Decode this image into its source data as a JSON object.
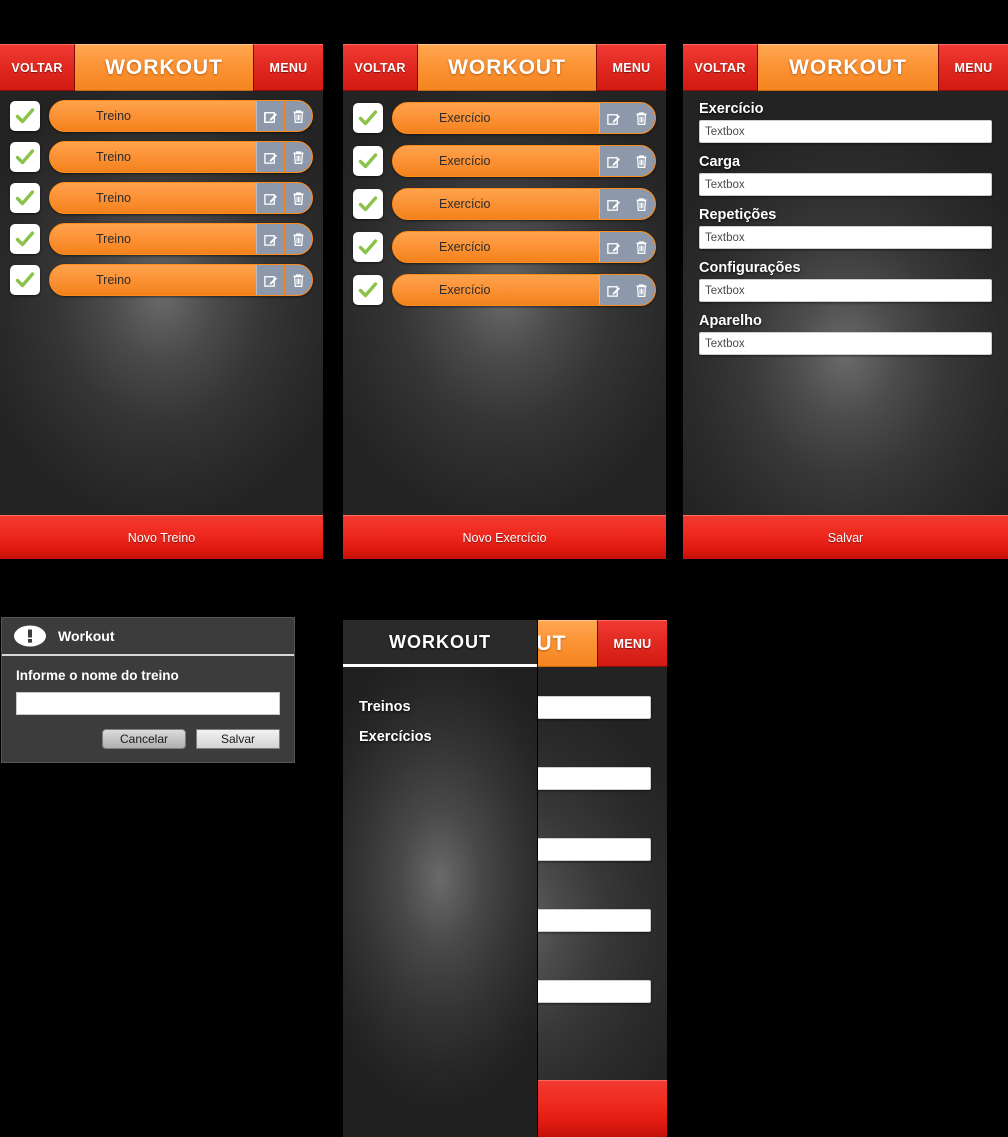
{
  "app": {
    "name": "Workout"
  },
  "header": {
    "back_label": "VOLTAR",
    "title": "WORKOUT",
    "menu_label": "MENU"
  },
  "colors": {
    "accent_orange": "#fb9233",
    "accent_red": "#e02020",
    "check_green": "#8bc34a",
    "action_button_bg": "#8d99ab",
    "panel_dark": "#2a2a2a"
  },
  "screens": {
    "workouts_list": {
      "title": "WORKOUT",
      "items": [
        {
          "label": "Treino",
          "checked": true
        },
        {
          "label": "Treino",
          "checked": true
        },
        {
          "label": "Treino",
          "checked": true
        },
        {
          "label": "Treino",
          "checked": true
        },
        {
          "label": "Treino",
          "checked": true
        }
      ],
      "row_actions": {
        "edit": "edit-icon",
        "delete": "trash-icon"
      },
      "primary_button": "Novo Treino"
    },
    "exercises_list": {
      "title": "WORKOUT",
      "items": [
        {
          "label": "Exercício",
          "checked": true
        },
        {
          "label": "Exercício",
          "checked": true
        },
        {
          "label": "Exercício",
          "checked": true
        },
        {
          "label": "Exercício",
          "checked": true
        },
        {
          "label": "Exercício",
          "checked": true
        }
      ],
      "row_actions": {
        "edit": "edit-icon",
        "delete": "trash-icon"
      },
      "primary_button": "Novo Exercício"
    },
    "exercise_form": {
      "title": "WORKOUT",
      "fields": [
        {
          "label": "Exercício",
          "value": "Textbox"
        },
        {
          "label": "Carga",
          "value": "Textbox"
        },
        {
          "label": "Repetições",
          "value": "Textbox"
        },
        {
          "label": "Configurações",
          "value": "Textbox"
        },
        {
          "label": "Aparelho",
          "value": "Textbox"
        }
      ],
      "primary_button": "Salvar"
    }
  },
  "dialog": {
    "icon": "alert-icon",
    "title": "Workout",
    "prompt": "Informe o nome do treino",
    "input_value": "",
    "cancel_label": "Cancelar",
    "save_label": "Salvar"
  },
  "drawer": {
    "title": "WORKOUT",
    "items": [
      {
        "label": "Treinos"
      },
      {
        "label": "Exercícios"
      }
    ]
  }
}
